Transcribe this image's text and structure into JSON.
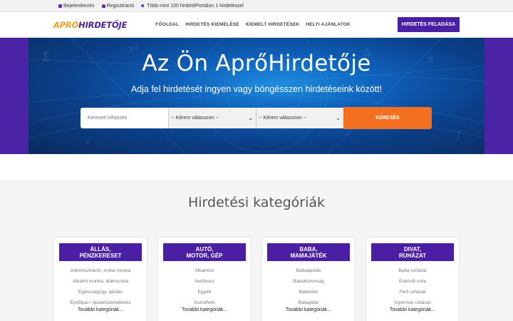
{
  "topbar": {
    "login": "Bejelentkezés",
    "register": "Regisztráció",
    "promo": "Több mint 100 hirdetőPortálon 1 hirdetéssel"
  },
  "logo": {
    "part1": "APRÓ",
    "part2": "HIRDETŐJE"
  },
  "nav": [
    {
      "label": "FŐOLDAL"
    },
    {
      "label": "HIRDETÉS KIEMELÉSE"
    },
    {
      "label": "KIEMELT HIRDETÉSEK"
    },
    {
      "label": "HELYI AJÁNLATOK"
    }
  ],
  "post_button": "HIRDETÉS FELADÁSA",
  "hero": {
    "title": "Az Ön AprÓHirdetője",
    "title_display": "Az Ön AprőHirdetője",
    "subtitle": "Adja fel hirdetését ingyen vagy böngésszen hirdetéseink között!"
  },
  "search": {
    "keyword_placeholder": "Keresett kifejezés",
    "select1": "-- Kérem válasszon --",
    "select2": "-- Kérem válasszon --",
    "button": "KERESÉS"
  },
  "categories_title": "Hirdetési kategóriák",
  "cards": [
    {
      "line1": "ÁLLÁS,",
      "line2": "PÉNZKERESET",
      "items": [
        "Adminisztráció, irodai munka",
        "Alkalmi munka, diákmunka",
        "Egészségügy, ápolás",
        "Építőipar / épületüzemeltetés"
      ],
      "more": "További kategóriák..."
    },
    {
      "line1": "AUTÓ,",
      "line2": "MOTOR, GÉP",
      "items": [
        "Alkatrész",
        "Autóbusz",
        "Egyéb",
        "Gumi/felni"
      ],
      "more": "További kategóriák..."
    },
    {
      "line1": "BABA,",
      "line2": "MAMAJÁTÉK",
      "items": [
        "Babaápolás",
        "Bababiztonság",
        "Babbútor",
        "Babajáték"
      ],
      "more": "További kategóriák..."
    },
    {
      "line1": "DIVAT,",
      "line2": "RUHÁZAT",
      "items": [
        "Baba ruházat",
        "Esküvői ruha",
        "Férfi ruházat",
        "Gyermek ruházat"
      ],
      "more": "További kategóriák..."
    }
  ],
  "colors": {
    "brand_purple": "#4b1fa3",
    "accent_orange": "#f37021",
    "logo_orange": "#f0a020"
  }
}
